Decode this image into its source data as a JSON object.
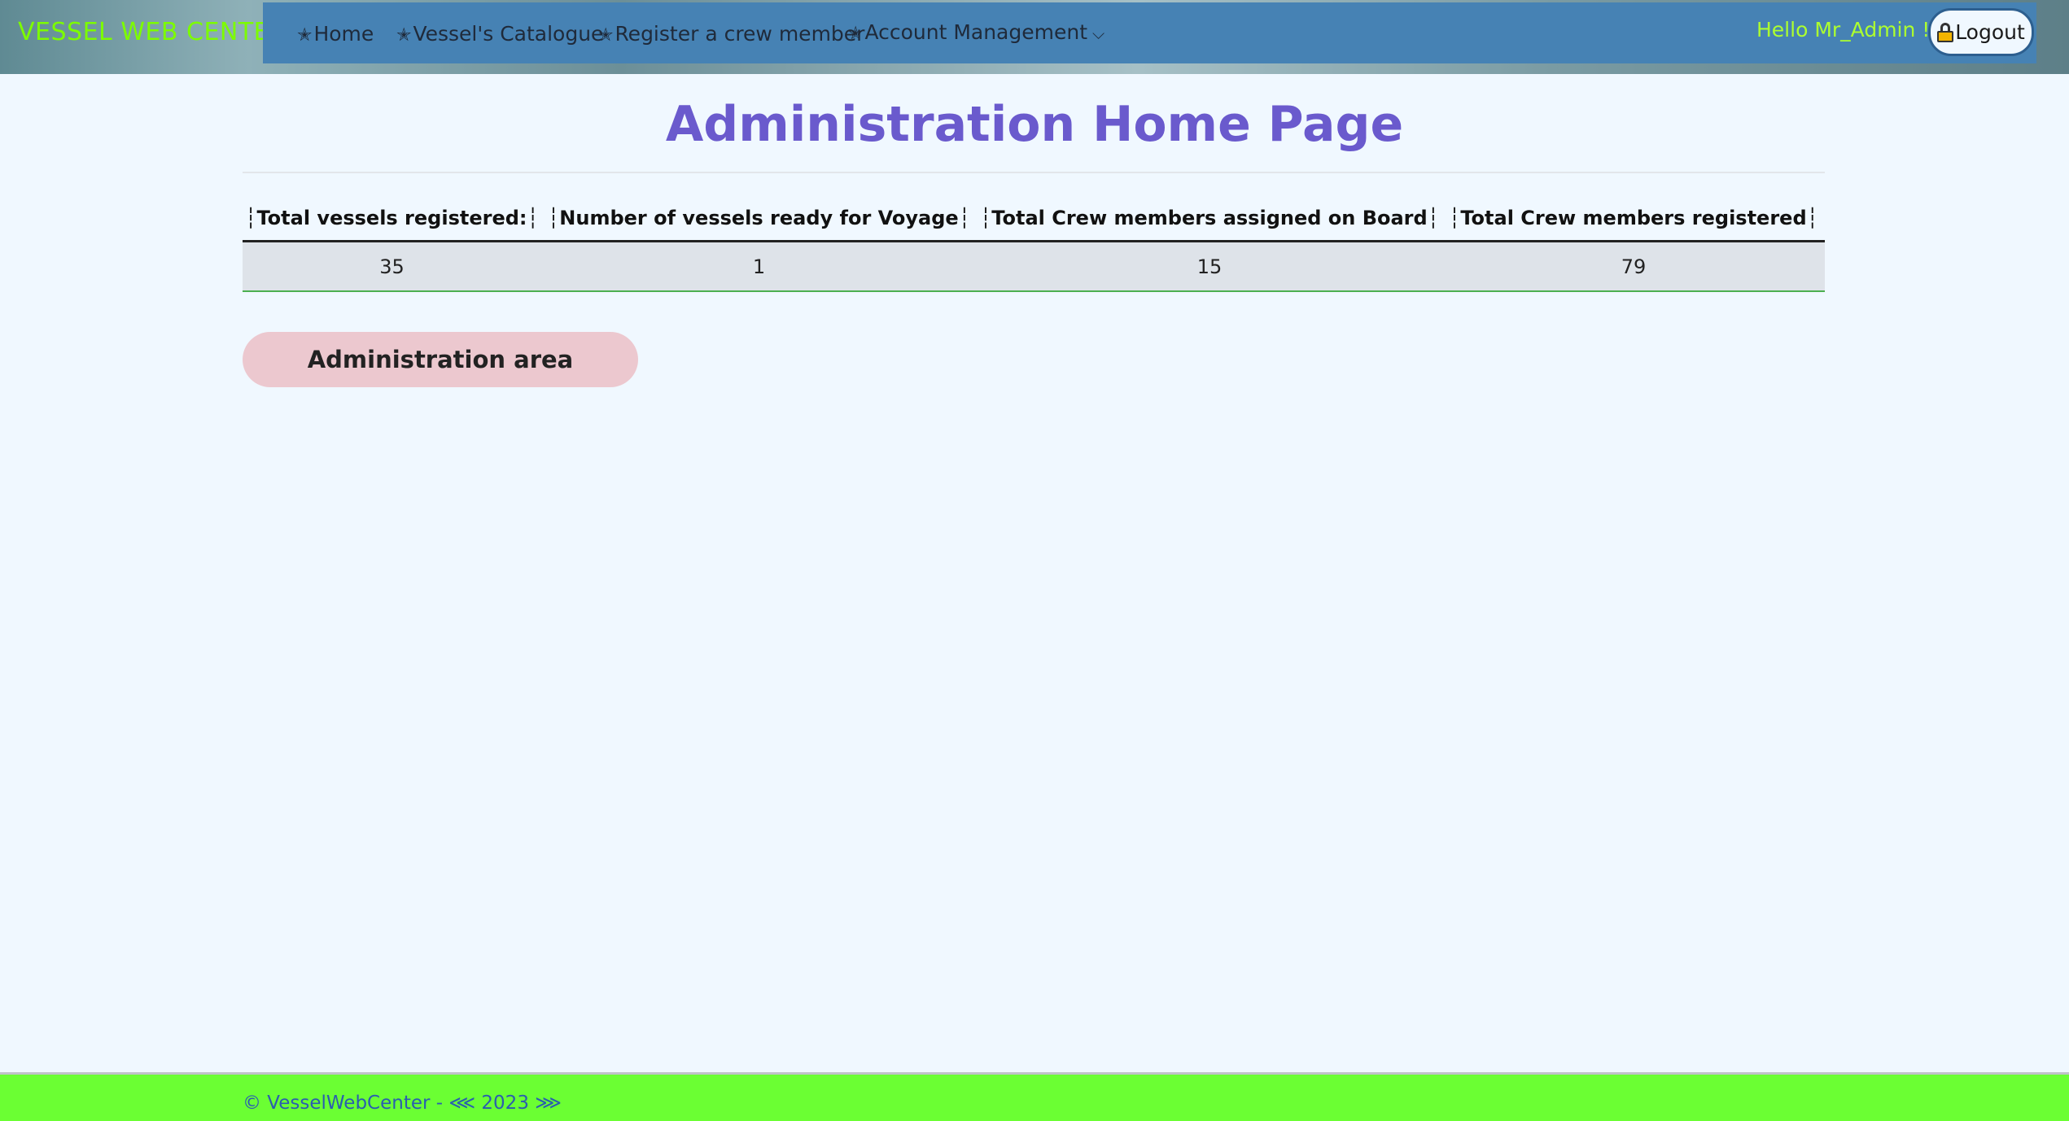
{
  "header": {
    "brand": "VESSEL WEB CENTER",
    "nav": {
      "home": "Home",
      "catalogue": "Vessel's Catalogue",
      "register": "Register a crew member",
      "account": "Account Management"
    },
    "greeting": "Hello Mr_Admin !",
    "logout_label": "Logout"
  },
  "main": {
    "title": "Administration Home Page",
    "stats": {
      "headers": [
        "┆Total vessels registered:┆",
        "┆Number of vessels ready for Voyage┆",
        "┆Total Crew members assigned on Board┆",
        "┆Total Crew members registered┆"
      ],
      "values": [
        "35",
        "1",
        "15",
        "79"
      ]
    },
    "admin_button_label": "Administration area"
  },
  "footer": {
    "text": "© VesselWebCenter - ⋘ 2023 ⋙"
  },
  "icons": {
    "nav_star": "star-icon",
    "dropdown": "chevron-down-icon",
    "logout": "lock-icon"
  },
  "colors": {
    "brand": "#7cfc00",
    "nav_bg": "#4682b4",
    "greeting": "#adff2f",
    "title": "#6a5acd",
    "admin_button_bg": "#ecc8cf",
    "footer_bg": "#6bff33",
    "footer_text": "#2a5db0"
  }
}
